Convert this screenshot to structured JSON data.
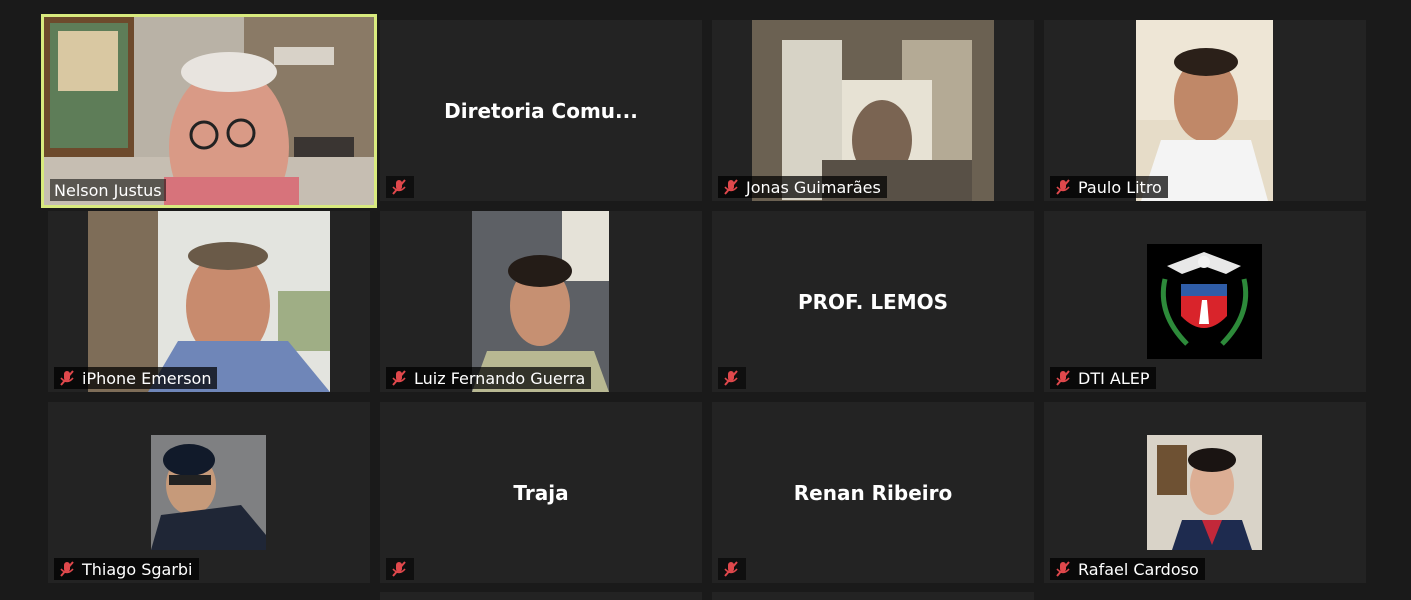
{
  "meeting": {
    "participants": [
      {
        "name": "Nelson Justus",
        "type": "video",
        "active": true,
        "muted": false
      },
      {
        "name": "Diretoria  Comu...",
        "type": "name",
        "muted": true
      },
      {
        "name": "Jonas Guimarães",
        "type": "video",
        "muted": true
      },
      {
        "name": "Paulo Litro",
        "type": "video",
        "muted": true
      },
      {
        "name": "iPhone Emerson",
        "type": "video",
        "muted": true
      },
      {
        "name": "Luiz Fernando Guerra",
        "type": "video",
        "muted": true
      },
      {
        "name": "PROF. LEMOS",
        "type": "name",
        "muted": true
      },
      {
        "name": "DTI ALEP",
        "type": "image",
        "muted": true
      },
      {
        "name": "Thiago Sgarbi",
        "type": "image",
        "muted": true
      },
      {
        "name": "Traja",
        "type": "name",
        "muted": true
      },
      {
        "name": "Renan Ribeiro",
        "type": "name",
        "muted": true
      },
      {
        "name": "Rafael Cardoso",
        "type": "image",
        "muted": true
      }
    ]
  },
  "colors": {
    "background": "#1a1a1a",
    "tile": "#232323",
    "active_speaker_border": "#d8ea7e",
    "muted_icon": "#e0484c"
  },
  "icons": {
    "muted": "microphone-muted-icon",
    "emblem": "parana-coat-of-arms"
  }
}
